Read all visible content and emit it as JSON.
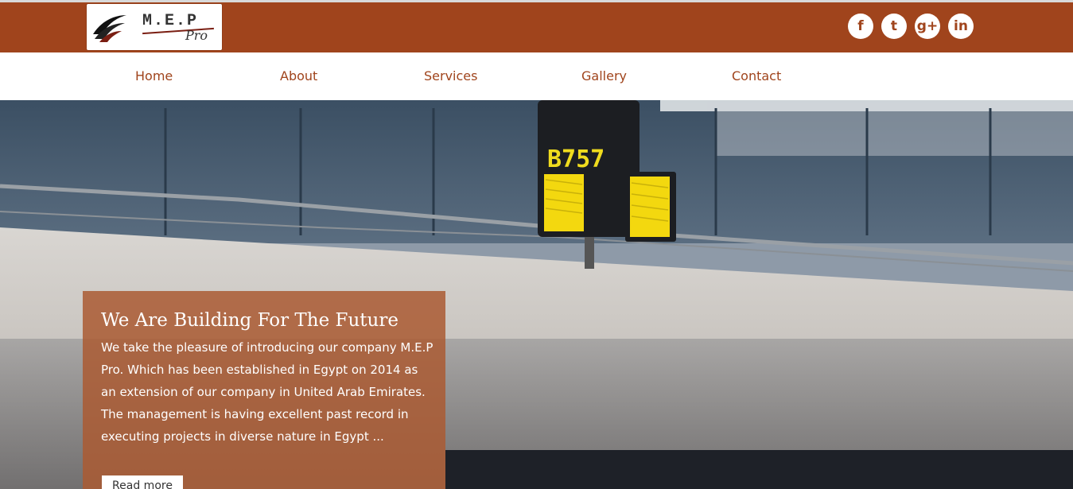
{
  "logo": {
    "brand": "M.E.P",
    "sub": "Pro"
  },
  "social": [
    {
      "icon": "facebook-icon",
      "glyph": "f"
    },
    {
      "icon": "twitter-icon",
      "glyph": "t"
    },
    {
      "icon": "google-plus-icon",
      "glyph": "g+"
    },
    {
      "icon": "linkedin-icon",
      "glyph": "in"
    }
  ],
  "nav": {
    "home": "Home",
    "about": "About",
    "services": "Services",
    "gallery": "Gallery",
    "contact": "Contact"
  },
  "hero": {
    "sign_text": "B757",
    "title": "We Are Building For The Future",
    "body": "We take the pleasure of introducing our company M.E.P Pro. Which has been established in Egypt on 2014 as an extension of our company in United Arab Emirates. The management is having excellent past record in executing projects in diverse nature in Egypt ...",
    "button": "Read more"
  },
  "colors": {
    "brand": "#a0441c",
    "card": "#aa5a32"
  }
}
